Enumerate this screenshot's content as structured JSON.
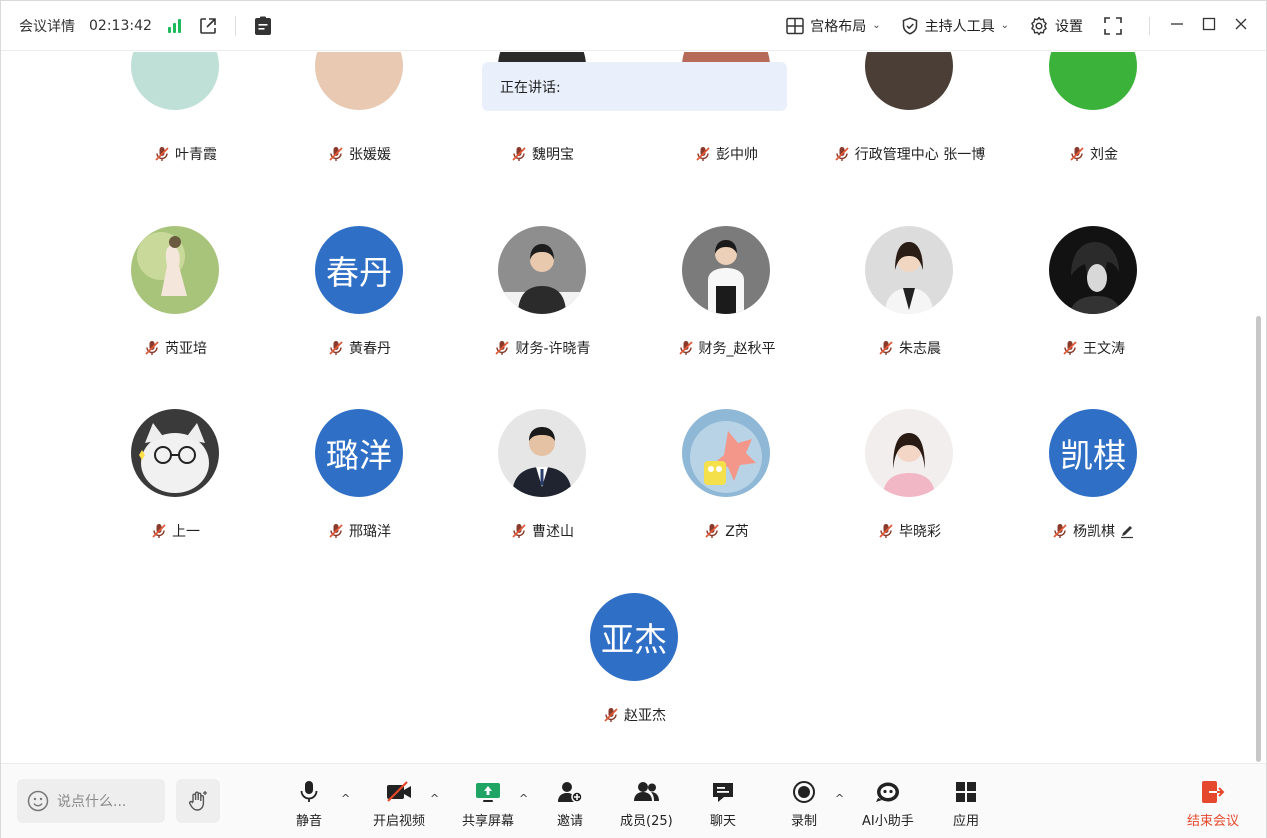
{
  "titlebar": {
    "title": "会议详情",
    "timer": "02:13:42",
    "layout_label": "宫格布局",
    "host_tools_label": "主持人工具",
    "settings_label": "设置"
  },
  "speaking": {
    "label": "正在讲话:"
  },
  "top_row": [
    {
      "name": "叶青霞"
    },
    {
      "name": "张媛媛"
    },
    {
      "name": "魏明宝"
    },
    {
      "name": "彭中帅"
    },
    {
      "name": "行政管理中心 张一博"
    },
    {
      "name": "刘金"
    }
  ],
  "row2": [
    {
      "name": "芮亚培",
      "avatar": "photo"
    },
    {
      "name": "黄春丹",
      "avatar_text": "春丹"
    },
    {
      "name": "财务-许晓青",
      "avatar": "photo"
    },
    {
      "name": "财务_赵秋平",
      "avatar": "photo"
    },
    {
      "name": "朱志晨",
      "avatar": "photo"
    },
    {
      "name": "王文涛",
      "avatar": "photo"
    }
  ],
  "row3": [
    {
      "name": "上一",
      "avatar": "photo"
    },
    {
      "name": "邢璐洋",
      "avatar_text": "璐洋"
    },
    {
      "name": "曹述山",
      "avatar": "photo"
    },
    {
      "name": "Z芮",
      "avatar": "photo"
    },
    {
      "name": "毕晓彩",
      "avatar": "photo"
    },
    {
      "name": "杨凯棋",
      "avatar_text": "凯棋"
    }
  ],
  "row4": [
    {
      "name": "赵亚杰",
      "avatar_text": "亚杰"
    }
  ],
  "toolbar": {
    "chat_placeholder": "说点什么...",
    "mute": "静音",
    "video": "开启视频",
    "share": "共享屏幕",
    "invite": "邀请",
    "members": "成员(25)",
    "chat": "聊天",
    "record": "录制",
    "ai": "AI小助手",
    "apps": "应用",
    "end": "结束会议"
  },
  "colors": {
    "avatar_blue": "#2f6fc6",
    "signal_green": "#1dbb5b",
    "share_green": "#1fa463",
    "end_red": "#e5482d",
    "speaking_bg": "#eaf0fb"
  }
}
